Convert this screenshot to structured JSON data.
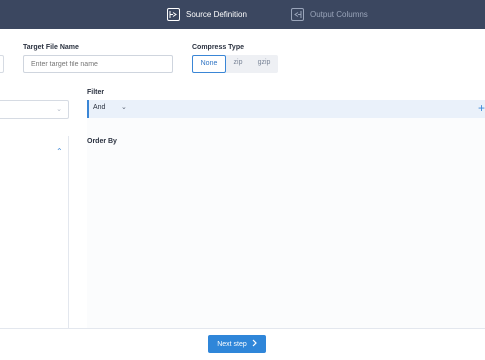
{
  "header": {
    "steps": [
      {
        "label": "Source Definition",
        "icon": "source-definition-icon",
        "active": true
      },
      {
        "label": "Output Columns",
        "icon": "output-columns-icon",
        "active": false
      }
    ]
  },
  "form": {
    "target_label": "Target File Name",
    "target_placeholder": "Enter target file name",
    "compress_label": "Compress Type",
    "compress_options": [
      "None",
      "zip",
      "gzip"
    ],
    "compress_selected": "None"
  },
  "panel": {
    "filter_label": "Filter",
    "filter_operator": "And",
    "order_label": "Order By"
  },
  "footer": {
    "next_label": "Next step"
  },
  "colors": {
    "header_bg": "#3b4760",
    "accent": "#2f86d9"
  }
}
